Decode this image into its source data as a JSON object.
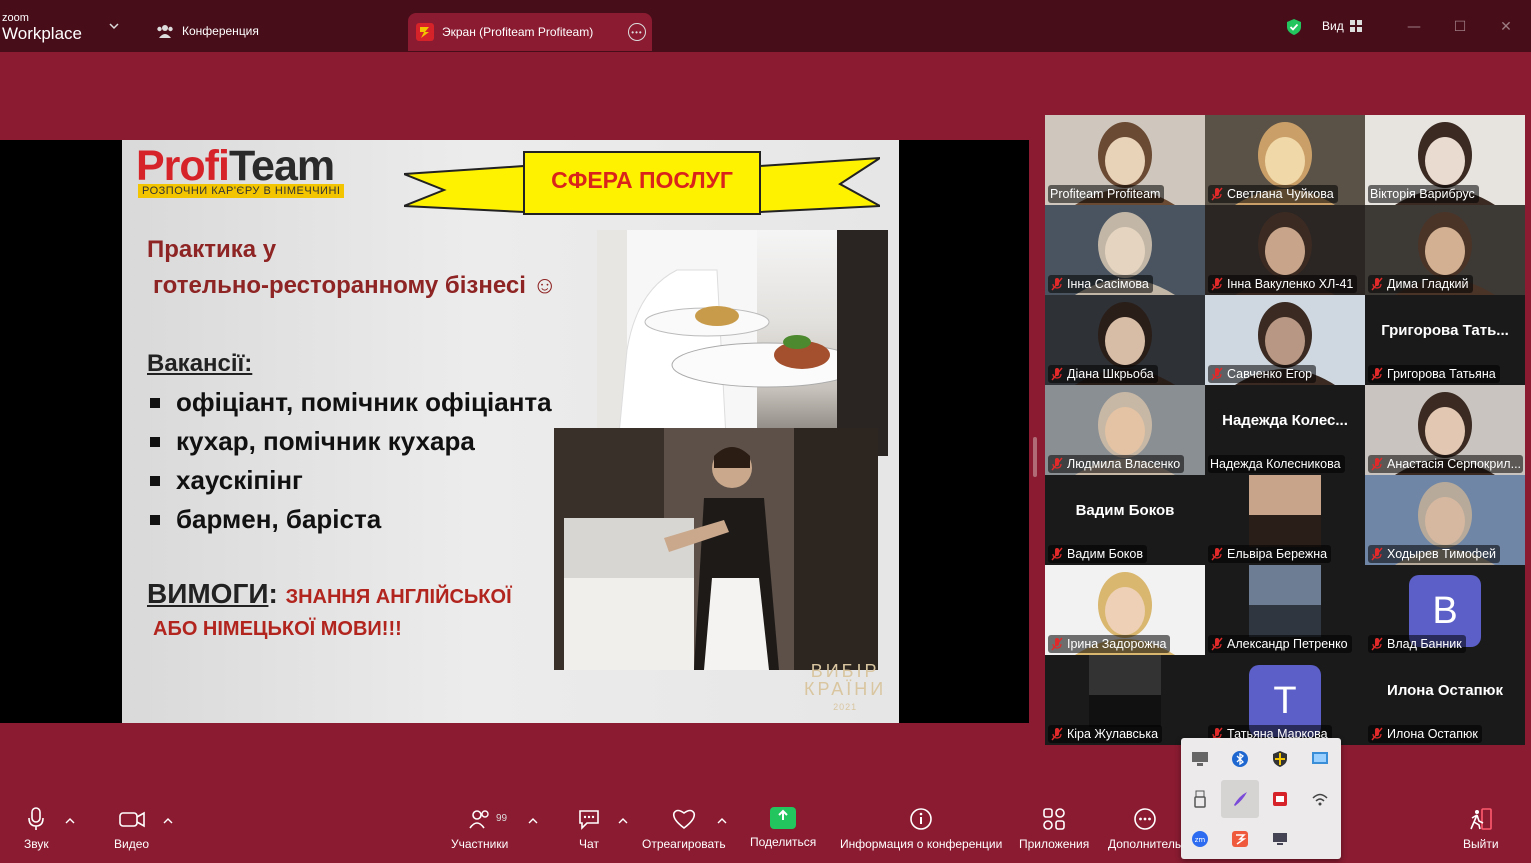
{
  "app": {
    "brand_small": "zoom",
    "brand_large": "Workplace"
  },
  "tabs": {
    "conference": "Конференция",
    "screen": "Экран (Profiteam Profiteam)"
  },
  "titlebar": {
    "view_label": "Вид"
  },
  "slide": {
    "logo_profi": "Profi",
    "logo_team": "Team",
    "logo_tagline": "РОЗПОЧНИ КАР'ЄРУ В НІМЕЧЧИНІ",
    "banner": "СФЕРА ПОСЛУГ",
    "heading_line1": "Практика у",
    "heading_line2": "готельно-ресторанному бізнесі ☺",
    "vacancies_label": "Вакансії:",
    "vacancies": [
      "офіціант, помічник офіціанта",
      "кухар, помічник кухара",
      "хаускіпінг",
      "бармен, баріста"
    ],
    "requirements_label": "ВИМОГИ",
    "requirements_colon": ":",
    "requirements_line1": "ЗНАННЯ АНГЛІЙСЬКОЇ",
    "requirements_line2": "АБО НІМЕЦЬКОЇ МОВИ!!!",
    "watermark_line1": "ВИБІР",
    "watermark_line2": "КРАЇНИ",
    "watermark_year": "2021"
  },
  "participants": [
    {
      "name": "Profiteam Profiteam",
      "muted": false,
      "video": true
    },
    {
      "name": "Светлана Чуйкова",
      "muted": true,
      "video": true
    },
    {
      "name": "Вікторія Варибрус",
      "muted": false,
      "video": true
    },
    {
      "name": "Інна Сасімова",
      "muted": true,
      "video": true
    },
    {
      "name": "Інна Вакуленко ХЛ-41",
      "muted": true,
      "video": true
    },
    {
      "name": "Дима Гладкий",
      "muted": true,
      "video": true
    },
    {
      "name": "Діана Шкрьоба",
      "muted": true,
      "video": true
    },
    {
      "name": "Савченко Егор",
      "muted": true,
      "video": true
    },
    {
      "name": "Григорова Татьяна",
      "muted": true,
      "video": false,
      "display": "Григорова  Тать..."
    },
    {
      "name": "Людмила Власенко",
      "muted": true,
      "video": true
    },
    {
      "name": "Надежда Колесникова",
      "muted": false,
      "video": false,
      "display": "Надежда  Колес..."
    },
    {
      "name": "Анастасія Серпокрил...",
      "muted": true,
      "video": true
    },
    {
      "name": "Вадим Боков",
      "muted": true,
      "video": false,
      "display": "Вадим Боков"
    },
    {
      "name": "Ельвіра Бережна",
      "muted": true,
      "video": true
    },
    {
      "name": "Ходырев Тимофей",
      "muted": true,
      "video": true
    },
    {
      "name": "Ірина Задорожна",
      "muted": true,
      "video": true
    },
    {
      "name": "Александр Петренко",
      "muted": true,
      "video": true
    },
    {
      "name": "Влад Банник",
      "muted": true,
      "video": false,
      "avatar": "B"
    },
    {
      "name": "Кіра Жулавська",
      "muted": true,
      "video": true
    },
    {
      "name": "Татьяна Маркова",
      "muted": true,
      "video": false,
      "avatar": "T"
    },
    {
      "name": "Илона Остапюк",
      "muted": true,
      "video": false,
      "display": "Илона Остапюк"
    }
  ],
  "toolbar": {
    "audio": "Звук",
    "video": "Видео",
    "participants": "Участники",
    "participants_count": "99",
    "chat": "Чат",
    "react": "Отреагировать",
    "share": "Поделиться",
    "info": "Информация о конференции",
    "apps": "Приложения",
    "more": "Дополнитель",
    "leave": "Выйти"
  },
  "colors": {
    "background": "#8a1b31",
    "titlebar": "#470d19",
    "share_green": "#22c55e",
    "active_speaker": "#31c85f",
    "avatar_bg": "#5b5fc7"
  }
}
